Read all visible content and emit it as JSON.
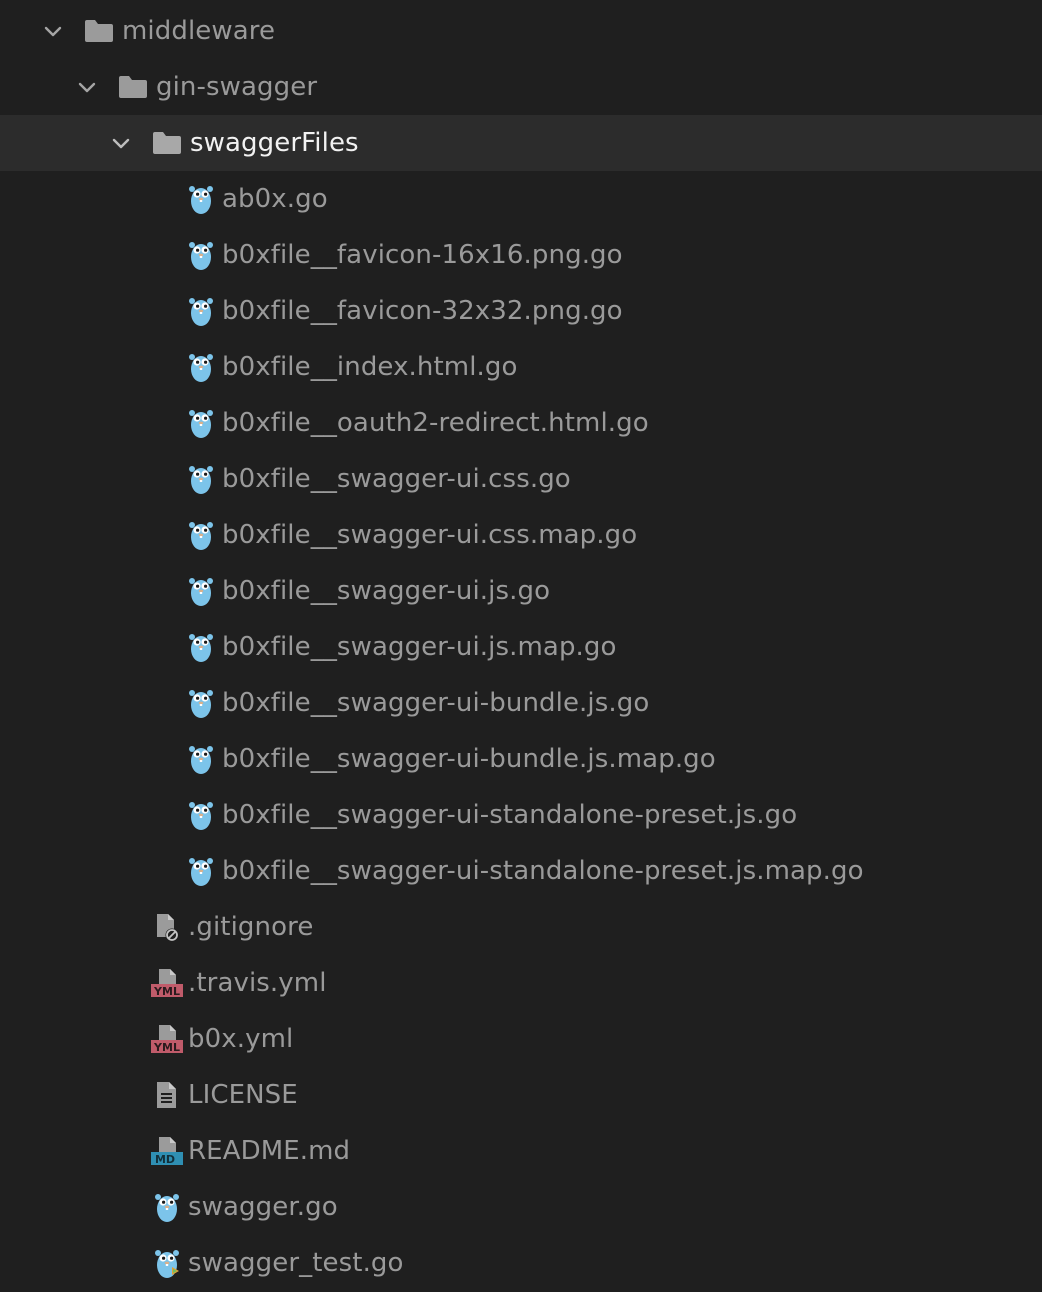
{
  "tree": {
    "folders": [
      {
        "label": "middleware",
        "icon": "folder-icon",
        "expanded": true
      },
      {
        "label": "gin-swagger",
        "icon": "folder-icon",
        "expanded": true
      },
      {
        "label": "swaggerFiles",
        "icon": "folder-icon",
        "expanded": true,
        "selected": true
      }
    ],
    "swaggerFiles": [
      {
        "label": "ab0x.go",
        "icon": "go-gopher-icon"
      },
      {
        "label": "b0xfile__favicon-16x16.png.go",
        "icon": "go-gopher-icon"
      },
      {
        "label": "b0xfile__favicon-32x32.png.go",
        "icon": "go-gopher-icon"
      },
      {
        "label": "b0xfile__index.html.go",
        "icon": "go-gopher-icon"
      },
      {
        "label": "b0xfile__oauth2-redirect.html.go",
        "icon": "go-gopher-icon"
      },
      {
        "label": "b0xfile__swagger-ui.css.go",
        "icon": "go-gopher-icon"
      },
      {
        "label": "b0xfile__swagger-ui.css.map.go",
        "icon": "go-gopher-icon"
      },
      {
        "label": "b0xfile__swagger-ui.js.go",
        "icon": "go-gopher-icon"
      },
      {
        "label": "b0xfile__swagger-ui.js.map.go",
        "icon": "go-gopher-icon"
      },
      {
        "label": "b0xfile__swagger-ui-bundle.js.go",
        "icon": "go-gopher-icon"
      },
      {
        "label": "b0xfile__swagger-ui-bundle.js.map.go",
        "icon": "go-gopher-icon"
      },
      {
        "label": "b0xfile__swagger-ui-standalone-preset.js.go",
        "icon": "go-gopher-icon"
      },
      {
        "label": "b0xfile__swagger-ui-standalone-preset.js.map.go",
        "icon": "go-gopher-icon"
      }
    ],
    "ginSwaggerFiles": [
      {
        "label": ".gitignore",
        "icon": "gitignore-file-icon"
      },
      {
        "label": ".travis.yml",
        "icon": "yml-file-icon",
        "badge": "YML"
      },
      {
        "label": "b0x.yml",
        "icon": "yml-file-icon",
        "badge": "YML"
      },
      {
        "label": "LICENSE",
        "icon": "text-file-icon"
      },
      {
        "label": "README.md",
        "icon": "markdown-file-icon",
        "badge": "MD"
      },
      {
        "label": "swagger.go",
        "icon": "go-gopher-icon"
      },
      {
        "label": "swagger_test.go",
        "icon": "go-test-gopher-icon"
      }
    ]
  },
  "colors": {
    "background": "#1f1f1f",
    "selected_row": "#2c2c2c",
    "text": "#9a9a9a",
    "selected_text": "#f2f2f2",
    "folder": "#9b9b9b",
    "gopher": "#7cc4ea",
    "yml_badge": "#c05b6a",
    "md_badge": "#2f8fb3"
  }
}
